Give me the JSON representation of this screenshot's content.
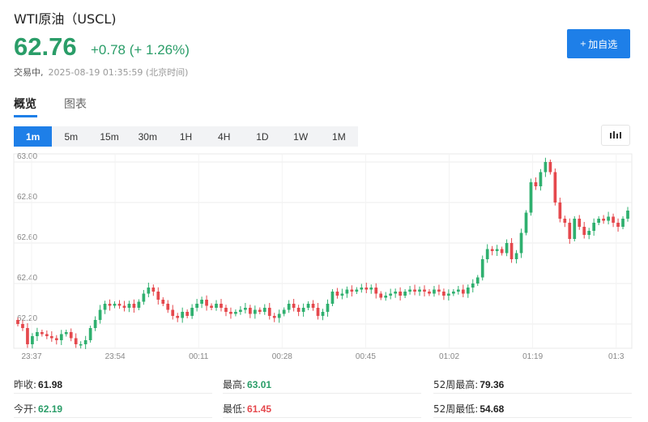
{
  "header": {
    "title": "WTI原油（USCL)",
    "price": "62.76",
    "change": "+0.78 (+ 1.26%)",
    "status": "交易中,",
    "timestamp": "2025-08-19 01:35:59 (北京时间)",
    "add_button_label": "加自选"
  },
  "tabs": [
    {
      "label": "概览",
      "active": true
    },
    {
      "label": "图表",
      "active": false
    }
  ],
  "periods": [
    {
      "label": "1m",
      "active": true
    },
    {
      "label": "5m",
      "active": false
    },
    {
      "label": "15m",
      "active": false
    },
    {
      "label": "30m",
      "active": false
    },
    {
      "label": "1H",
      "active": false
    },
    {
      "label": "4H",
      "active": false
    },
    {
      "label": "1D",
      "active": false
    },
    {
      "label": "1W",
      "active": false
    },
    {
      "label": "1M",
      "active": false
    }
  ],
  "colors": {
    "up": "#2fb06f",
    "down": "#e5484d",
    "accent": "#1e7fe8"
  },
  "chart_data": {
    "type": "candlestick",
    "y_ticks": [
      "63.00",
      "62.80",
      "62.60",
      "62.40",
      "62.20"
    ],
    "ylim": [
      62.08,
      63.04
    ],
    "x_ticks": [
      "23:37",
      "23:54",
      "00:11",
      "00:28",
      "00:45",
      "01:02",
      "01:19",
      "01:3"
    ],
    "grid": true,
    "close": [
      62.2,
      62.18,
      62.1,
      62.14,
      62.16,
      62.15,
      62.14,
      62.13,
      62.12,
      62.15,
      62.16,
      62.13,
      62.1,
      62.1,
      62.12,
      62.18,
      62.22,
      62.27,
      62.3,
      62.29,
      62.3,
      62.29,
      62.28,
      62.3,
      62.28,
      62.31,
      62.35,
      62.38,
      62.36,
      62.32,
      62.3,
      62.27,
      62.24,
      62.23,
      62.26,
      62.24,
      62.28,
      62.3,
      62.32,
      62.29,
      62.28,
      62.3,
      62.28,
      62.26,
      62.25,
      62.26,
      62.27,
      62.28,
      62.25,
      62.27,
      62.26,
      62.28,
      62.24,
      62.23,
      62.25,
      62.27,
      62.3,
      62.28,
      62.26,
      62.28,
      62.3,
      62.28,
      62.24,
      62.26,
      62.3,
      62.36,
      62.34,
      62.35,
      62.37,
      62.36,
      62.37,
      62.38,
      62.37,
      62.38,
      62.35,
      62.33,
      62.34,
      62.35,
      62.36,
      62.34,
      62.36,
      62.37,
      62.36,
      62.37,
      62.36,
      62.35,
      62.37,
      62.36,
      62.34,
      62.35,
      62.36,
      62.37,
      62.35,
      62.38,
      62.4,
      62.43,
      62.52,
      62.57,
      62.56,
      62.57,
      62.55,
      62.6,
      62.52,
      62.55,
      62.65,
      62.75,
      62.9,
      62.88,
      62.95,
      63.0,
      62.95,
      62.8,
      62.72,
      62.7,
      62.62,
      62.72,
      62.68,
      62.64,
      62.66,
      62.7,
      62.72,
      62.71,
      62.73,
      62.7,
      62.68,
      62.72,
      62.76
    ]
  },
  "stats": {
    "prev_close": {
      "label": "昨收:",
      "value": "61.98"
    },
    "open": {
      "label": "今开:",
      "value": "62.19"
    },
    "high": {
      "label": "最高:",
      "value": "63.01"
    },
    "low": {
      "label": "最低:",
      "value": "61.45"
    },
    "w52_high": {
      "label": "52周最高:",
      "value": "79.36"
    },
    "w52_low": {
      "label": "52周最低:",
      "value": "54.68"
    }
  }
}
